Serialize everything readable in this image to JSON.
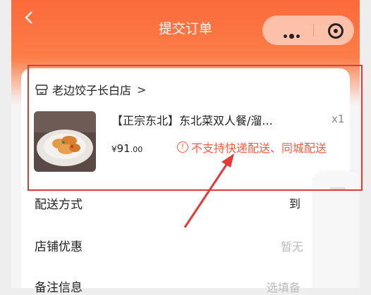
{
  "header": {
    "title": "提交订单",
    "back_icon": "chevron-left-icon",
    "menu_icon": "more-dots-icon",
    "close_icon": "target-circle-icon"
  },
  "store": {
    "name": "老边饺子长白店",
    "icon": "store-icon",
    "chevron": ">"
  },
  "product": {
    "name": "【正宗东北】东北菜双人餐/溜...",
    "quantity": "x1",
    "price_currency": "¥",
    "price_integer": "91",
    "price_decimal": ".00",
    "delivery_warning": "不支持快递配送、同城配送",
    "warning_icon": "info-circle-icon",
    "warning_icon_glyph": "!"
  },
  "rows": {
    "delivery_label": "配送方式",
    "delivery_value": "到",
    "discount_label": "店铺优惠",
    "discount_value": "暂无",
    "note_label": "备注信息",
    "note_value": "选填备"
  },
  "colors": {
    "accent": "#fb6a3a",
    "warning": "#ff5a3c",
    "annotation": "#e53935"
  }
}
